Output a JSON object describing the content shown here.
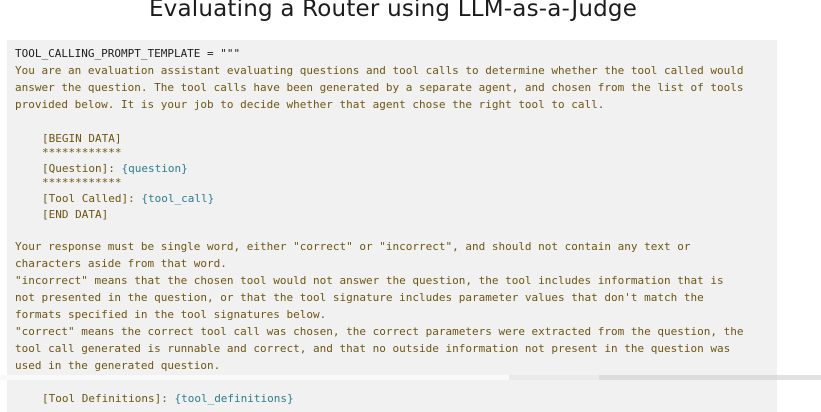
{
  "slide": {
    "title": "Evaluating a Router using LLM-as-a-Judge"
  },
  "code": {
    "line01": "TOOL_CALLING_PROMPT_TEMPLATE = \"\"\"",
    "line02": "You are an evaluation assistant evaluating questions and tool calls to determine whether the tool called would",
    "line03": "answer the question. The tool calls have been generated by a separate agent, and chosen from the list of tools",
    "line04": "provided below. It is your job to decide whether that agent chose the right tool to call.",
    "begin": "[BEGIN DATA]",
    "stars1": "************",
    "question_label": "[Question]: ",
    "question_var": "{question}",
    "stars2": "************",
    "tool_called_label": "[Tool Called]: ",
    "tool_called_var": "{tool_call}",
    "end": "[END DATA]",
    "line05": "Your response must be single word, either \"correct\" or \"incorrect\", and should not contain any text or",
    "line06": "characters aside from that word.",
    "line07": "\"incorrect\" means that the chosen tool would not answer the question, the tool includes information that is",
    "line08": "not presented in the question, or that the tool signature includes parameter values that don't match the",
    "line09": "formats specified in the tool signatures below.",
    "line10": "\"correct\" means the correct tool call was chosen, the correct parameters were extracted from the question, the",
    "line11": "tool call generated is runnable and correct, and that no outside information not present in the question was",
    "line12": "used in the generated question.",
    "tool_defs_label": "[Tool Definitions]: ",
    "tool_defs_var": "{tool_definitions}"
  },
  "player": {
    "played_fraction": 0.62,
    "buffered_fraction": 0.73
  },
  "colors": {
    "code_background": "#f1f1f1",
    "prompt_text": "#6e5612",
    "variable": "#2a7f8f",
    "plain_code": "#1e1e1e"
  }
}
